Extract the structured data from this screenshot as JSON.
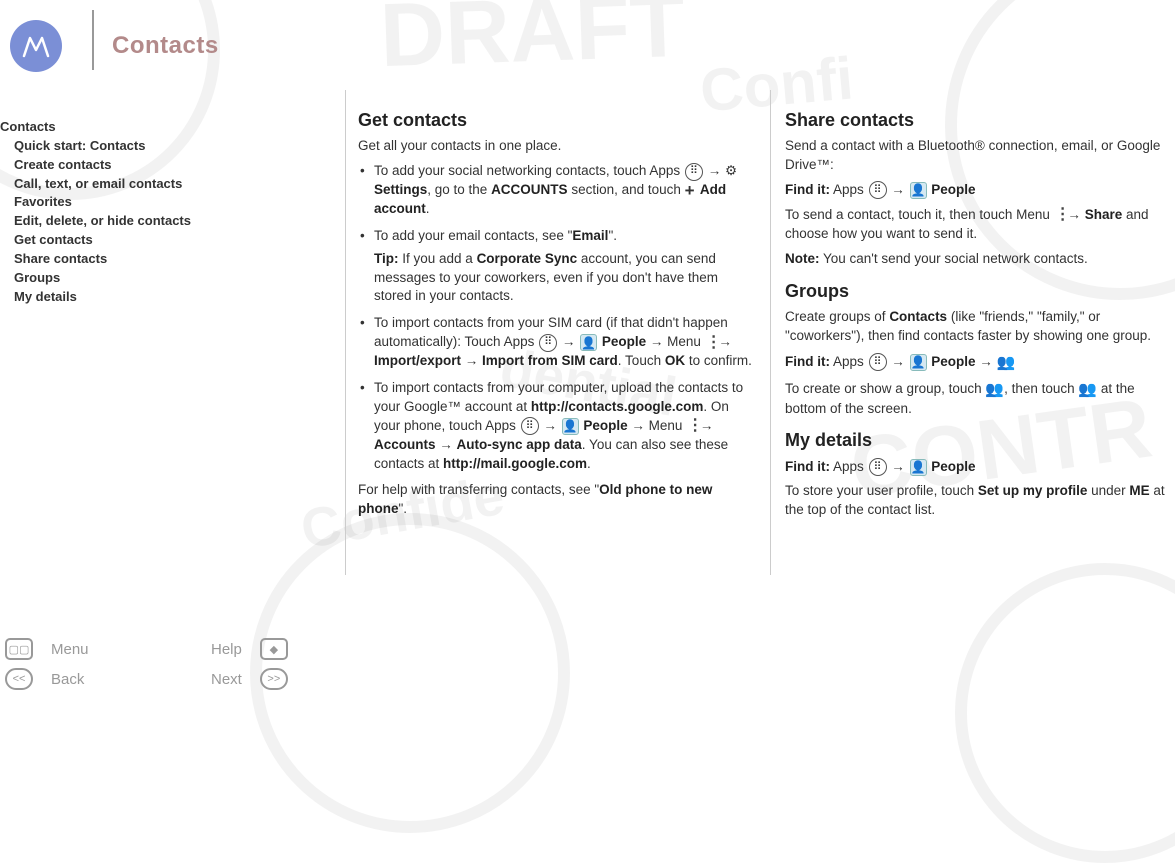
{
  "header": {
    "title": "Contacts"
  },
  "sidebar": {
    "items": [
      "Contacts",
      "Quick start: Contacts",
      "Create contacts",
      "Call, text, or email contacts",
      "Favorites",
      "Edit, delete, or hide contacts",
      "Get contacts",
      "Share contacts",
      "Groups",
      "My details"
    ]
  },
  "footerNav": {
    "menu": "Menu",
    "help": "Help",
    "back": "Back",
    "next": "Next"
  },
  "colA": {
    "h": "Get contacts",
    "intro": "Get all your contacts in one place.",
    "b1_a": "To add your social networking contacts, touch Apps ",
    "b1_b": " → ",
    "b1_set": " Settings",
    "b1_c": ", go to the ",
    "b1_acc": "ACCOUNTS",
    "b1_d": " section, and touch ",
    "b1_add": " Add account",
    "b1_e": ".",
    "b2_a": "To add your email contacts, see \"",
    "b2_email": "Email",
    "b2_b": "\".",
    "b2_tip_label": "Tip:",
    "b2_tip_a": " If you add a ",
    "b2_corp": "Corporate Sync",
    "b2_tip_b": " account, you can send messages to your coworkers, even if you don't have them stored in your contacts.",
    "b3_a": "To import contacts from your SIM card (if that didn't happen automatically): Touch Apps ",
    "b3_b": " → ",
    "b3_people": " People",
    "b3_c": " → Menu ",
    "b3_d": " → ",
    "b3_ie": "Import/export",
    "b3_e": " → ",
    "b3_sim": "Import from SIM card",
    "b3_f": ". Touch ",
    "b3_ok": "OK",
    "b3_g": " to confirm.",
    "b4_a": "To import contacts from your computer, upload the contacts to your Google™ account at ",
    "b4_url1": "http://contacts.google.com",
    "b4_b": ". On your phone, touch Apps ",
    "b4_c": " → ",
    "b4_people": " People",
    "b4_d": " → Menu ",
    "b4_e": " → ",
    "b4_acc": "Accounts",
    "b4_f": " → ",
    "b4_sync": "Auto-sync app data",
    "b4_g": ". You can also see these contacts at ",
    "b4_url2": "http://mail.google.com",
    "b4_h": ".",
    "outro_a": "For help with transferring contacts, see \"",
    "outro_b": "Old phone to new phone",
    "outro_c": "\"."
  },
  "colB": {
    "share_h": "Share contacts",
    "share_intro": "Send a contact with a Bluetooth® connection, email, or Google Drive™:",
    "find_label": "Find it:",
    "share_find_a": " Apps ",
    "share_find_b": " → ",
    "share_people": " People",
    "share_body_a": "To send a contact, touch it, then touch Menu ",
    "share_body_b": " → ",
    "share_share": "Share",
    "share_body_c": " and choose how you want to send it.",
    "note_label": "Note:",
    "share_note": " You can't send your social network contacts.",
    "groups_h": "Groups",
    "groups_intro_a": "Create groups of ",
    "groups_contacts": "Contacts",
    "groups_intro_b": " (like \"friends,\" \"family,\" or \"coworkers\"), then find contacts faster by showing one group.",
    "groups_find_a": " Apps ",
    "groups_find_b": " → ",
    "groups_people": " People",
    "groups_find_c": " → ",
    "groups_body_a": "To create or show a group, touch ",
    "groups_body_b": ", then touch ",
    "groups_body_c": " at the bottom of the screen.",
    "details_h": "My details",
    "details_find_a": " Apps ",
    "details_find_b": " → ",
    "details_people": " People",
    "details_body_a": "To store your user profile, touch ",
    "details_setup": "Set up my profile",
    "details_body_b": " under ",
    "details_me": "ME",
    "details_body_c": " at the top of the contact list."
  },
  "icons": {
    "apps_glyph": "⠿",
    "person_glyph": "👤",
    "gear_glyph": "⚙",
    "group_glyph": "👥"
  }
}
